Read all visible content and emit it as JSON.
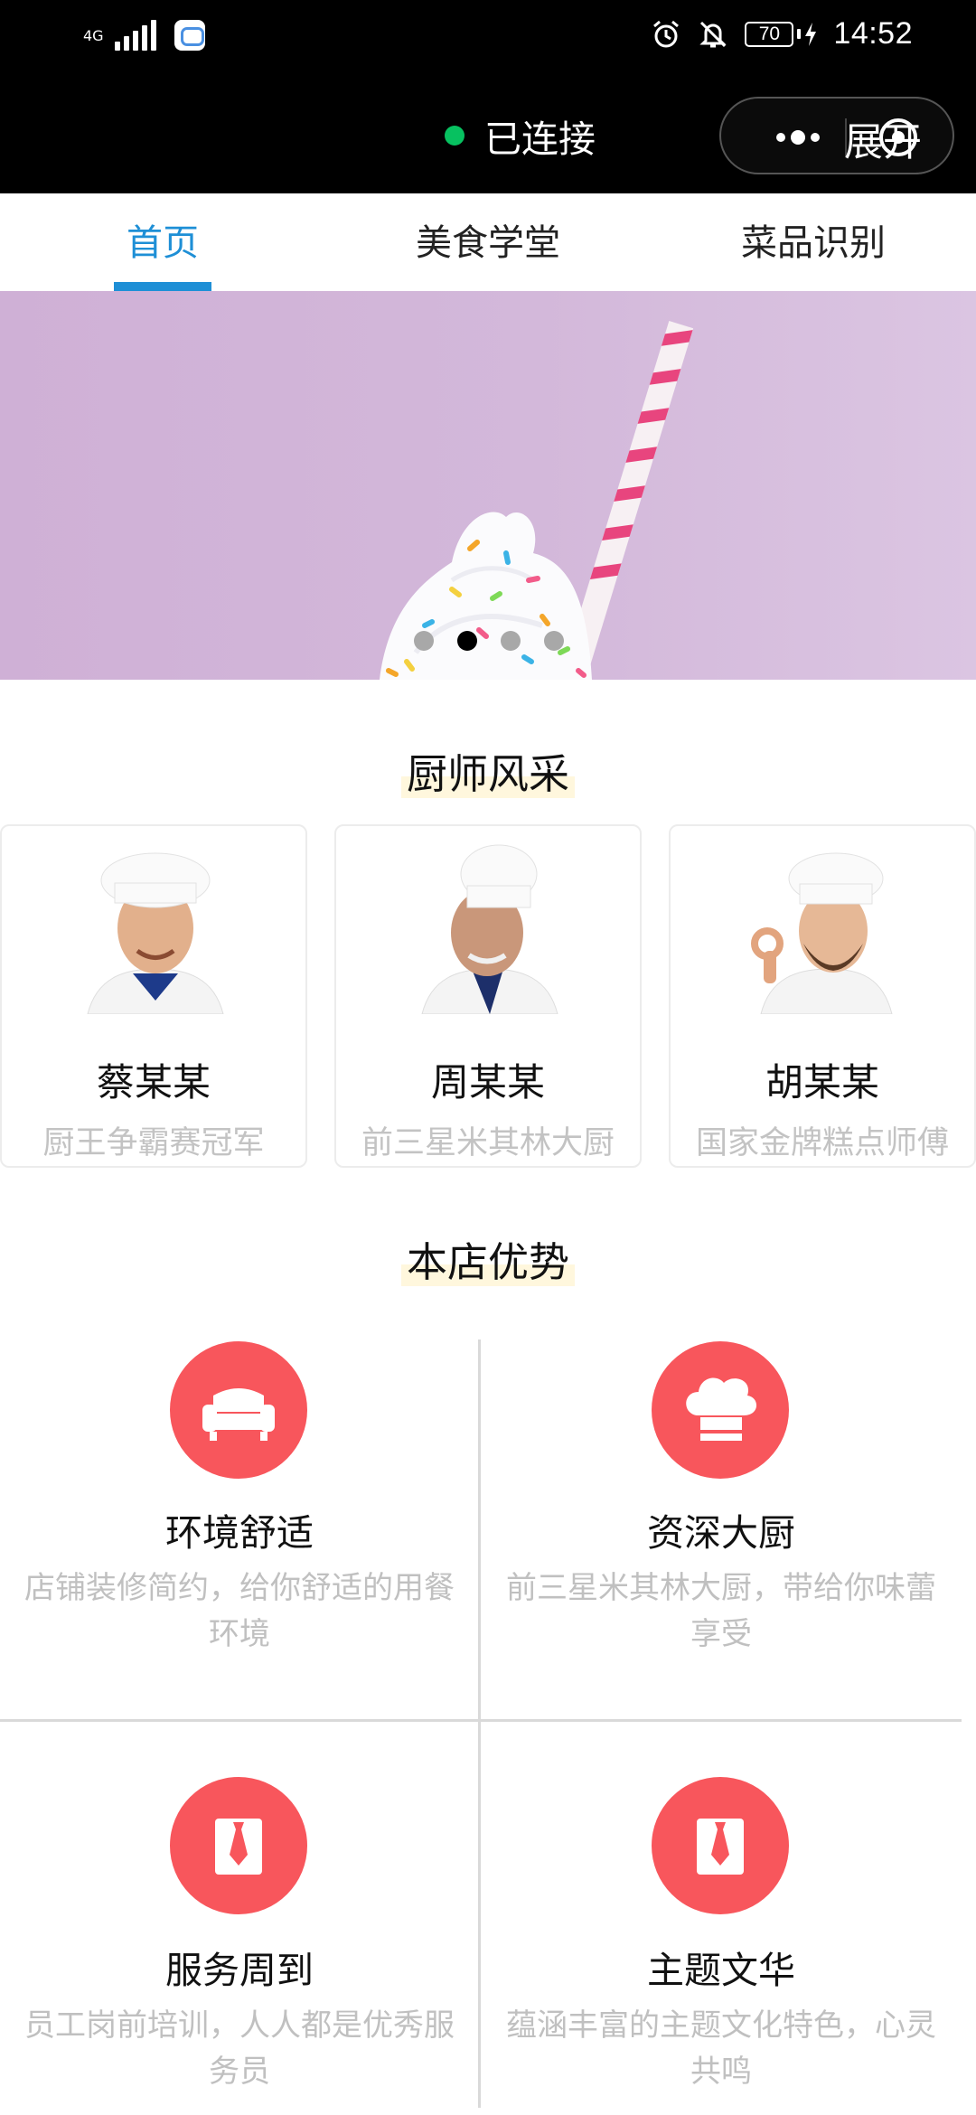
{
  "status_bar": {
    "network": "4G",
    "battery": "70",
    "time": "14:52"
  },
  "mini_program": {
    "connection_status": "已连接",
    "capsule_label": "展开"
  },
  "tabs": [
    {
      "label": "首页",
      "active": true
    },
    {
      "label": "美食学堂",
      "active": false
    },
    {
      "label": "菜品识别",
      "active": false
    }
  ],
  "banner": {
    "slide_count": 4,
    "active_slide": 2
  },
  "chefs_section": {
    "title": "厨师风采",
    "chefs": [
      {
        "name": "蔡某某",
        "title": "厨王争霸赛冠军"
      },
      {
        "name": "周某某",
        "title": "前三星米其林大厨"
      },
      {
        "name": "胡某某",
        "title": "国家金牌糕点师傅"
      }
    ]
  },
  "advantages_section": {
    "title": "本店优势",
    "items": [
      {
        "icon": "sofa-icon",
        "title": "环境舒适",
        "desc": "店铺装修简约，给你舒适的用餐环境"
      },
      {
        "icon": "chef-hat-icon",
        "title": "资深大厨",
        "desc": "前三星米其林大厨，带给你味蕾享受"
      },
      {
        "icon": "necktie-icon",
        "title": "服务周到",
        "desc": "员工岗前培训，人人都是优秀服务员"
      },
      {
        "icon": "necktie-icon",
        "title": "主题文华",
        "desc": "蕴涵丰富的主题文化特色，心灵共鸣"
      }
    ]
  },
  "colors": {
    "accent": "#1e8fd6",
    "icon_bg": "#f8565c",
    "connected": "#07c160"
  }
}
